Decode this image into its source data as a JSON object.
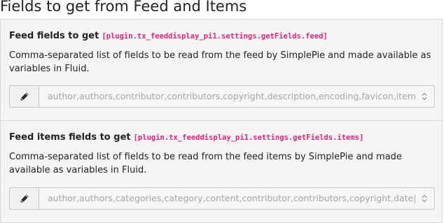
{
  "section": {
    "title": "Fields to get from Feed and Items"
  },
  "fields": [
    {
      "label": "Feed fields to get",
      "path": "[plugin.tx_feeddisplay_pi1.settings.getFields.feed]",
      "description": "Comma-separated list of fields to be read from the feed by SimplePie and made available as variables in Fluid.",
      "value": "author,authors,contributor,contributors,copyright,description,encoding,favicon,items,item_quantity,language,link,links,permalink,title,type",
      "edit_icon": "pencil-icon",
      "select_icon": "up-down-chevron-icon"
    },
    {
      "label": "Feed items fields to get",
      "path": "[plugin.tx_feeddisplay_pi1.settings.getFields.items]",
      "description": "Comma-separated list of fields to be read from the feed items by SimplePie and made available as variables in Fluid.",
      "value": "author,authors,categories,category,content,contributor,contributors,copyright,date|U,description,enclosure,enclosures,id,link,links,permalink,title",
      "edit_icon": "pencil-icon",
      "select_icon": "up-down-chevron-icon"
    }
  ]
}
